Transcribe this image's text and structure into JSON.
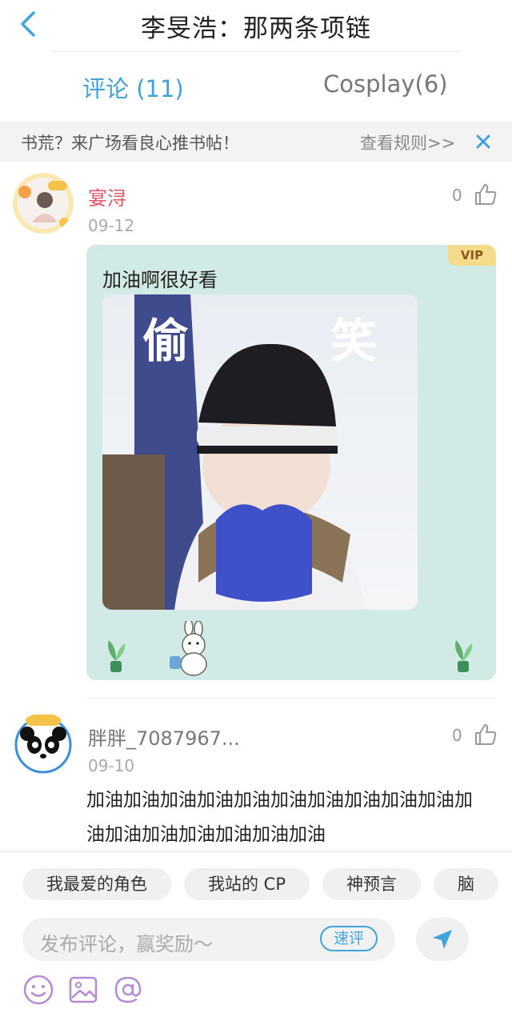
{
  "nav": {
    "title": "李旻浩：那两条项链",
    "back_icon": "chevron-left-icon"
  },
  "tabs": [
    {
      "label": "评论 (11)",
      "active": true
    },
    {
      "label": "Cosplay(6)",
      "active": false
    }
  ],
  "banner": {
    "text": "书荒？来广场看良心推书帖！",
    "rules": "查看规则>>",
    "close_icon": "close-icon"
  },
  "comments": [
    {
      "username": "宴浔",
      "date": "09-12",
      "likes": "0",
      "vip_badge": "VIP",
      "text": "加油啊很好看",
      "image_text": [
        "偷",
        "笑"
      ]
    },
    {
      "username": "胖胖_7087967...",
      "date": "09-10",
      "likes": "0",
      "text": "加油加油加油加油加油加油加油加油加油加油加油加油加油加油加油加油加油"
    }
  ],
  "chips": [
    "我最爱的角色",
    "我站的 CP",
    "神预言",
    "脑"
  ],
  "input": {
    "placeholder": "发布评论，赢奖励～",
    "quick_label": "速评"
  },
  "colors": {
    "accent": "#3fa3dc",
    "username_red": "#e0556a",
    "vip_bg": "#d1eae6",
    "tool_purple": "#b58ad6"
  }
}
